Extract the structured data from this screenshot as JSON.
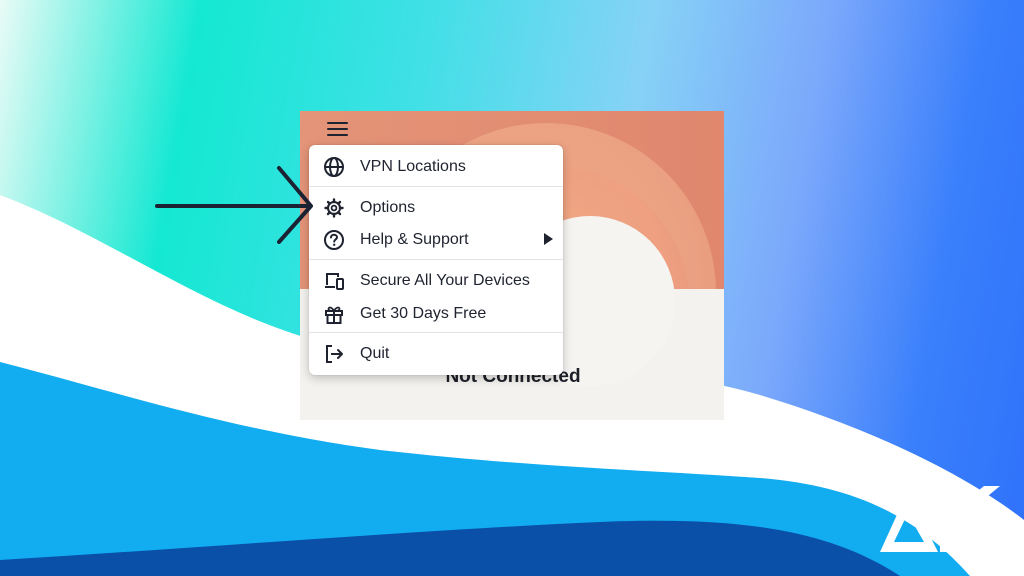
{
  "app": {
    "status": "Not Connected"
  },
  "menu": {
    "items": [
      {
        "label": "VPN Locations",
        "icon": "globe-icon"
      },
      {
        "label": "Options",
        "icon": "gear-icon"
      },
      {
        "label": "Help & Support",
        "icon": "help-circle-icon",
        "has_submenu": true
      },
      {
        "label": "Secure All Your Devices",
        "icon": "devices-icon"
      },
      {
        "label": "Get 30 Days Free",
        "icon": "gift-icon"
      },
      {
        "label": "Quit",
        "icon": "quit-icon"
      }
    ]
  },
  "colors": {
    "menu_text": "#1f2330",
    "header_accent": "#e49478",
    "annotation_arrow": "#1a2233",
    "wave_light_blue": "#12acf0",
    "wave_dark_blue": "#0a4fa8"
  },
  "annotation": {
    "arrow_points_to": "Options"
  }
}
